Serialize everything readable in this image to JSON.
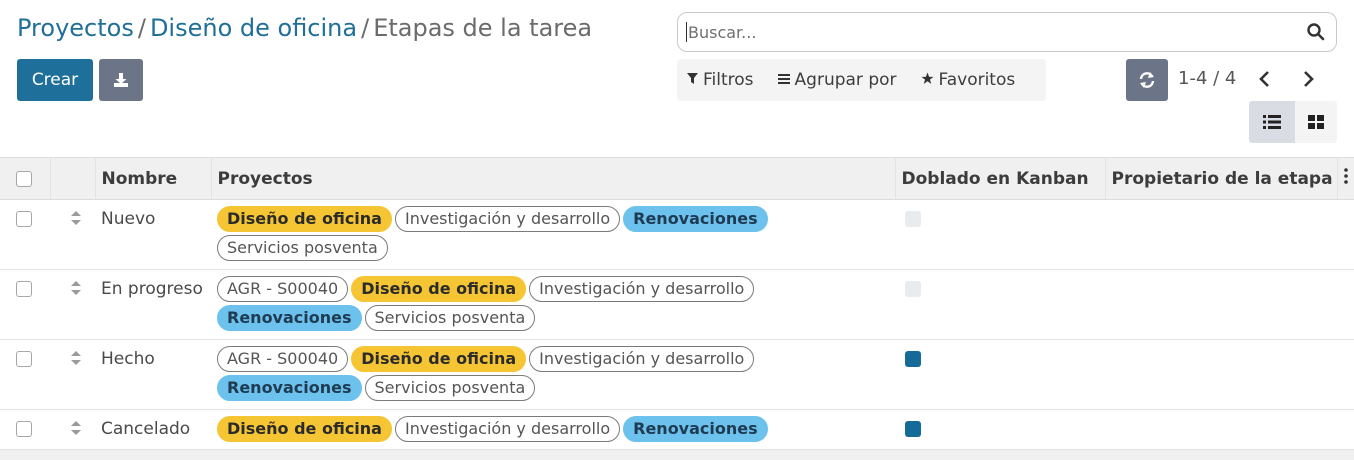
{
  "breadcrumb": {
    "items": [
      "Proyectos",
      "Diseño de oficina"
    ],
    "separator": "/",
    "current": "Etapas de la tarea"
  },
  "toolbar": {
    "create_label": "Crear",
    "download_icon": "download-icon"
  },
  "search": {
    "placeholder": "Buscar..."
  },
  "filters": {
    "filters_label": "Filtros",
    "group_by_label": "Agrupar por",
    "favorites_label": "Favoritos"
  },
  "pager": {
    "value": "1-4 / 4"
  },
  "table": {
    "headers": {
      "name": "Nombre",
      "projects": "Proyectos",
      "folded": "Doblado en Kanban",
      "owner": "Propietario de la etapa"
    },
    "rows": [
      {
        "name": "Nuevo",
        "tags": [
          "Diseño de oficina",
          "Investigación y desarrollo",
          "Renovaciones",
          "Servicios posventa"
        ],
        "folded": false
      },
      {
        "name": "En progreso",
        "tags": [
          "AGR - S00040",
          "Diseño de oficina",
          "Investigación y desarrollo",
          "Renovaciones",
          "Servicios posventa"
        ],
        "folded": false
      },
      {
        "name": "Hecho",
        "tags": [
          "AGR - S00040",
          "Diseño de oficina",
          "Investigación y desarrollo",
          "Renovaciones",
          "Servicios posventa"
        ],
        "folded": true
      },
      {
        "name": "Cancelado",
        "tags": [
          "Diseño de oficina",
          "Investigación y desarrollo",
          "Renovaciones"
        ],
        "folded": true
      }
    ]
  },
  "colors": {
    "primary": "#1e6f99",
    "secondary": "#6c7587",
    "tag_yellow": "#f6c534",
    "tag_blue": "#6cc1ed",
    "folded_on": "#166a98"
  }
}
